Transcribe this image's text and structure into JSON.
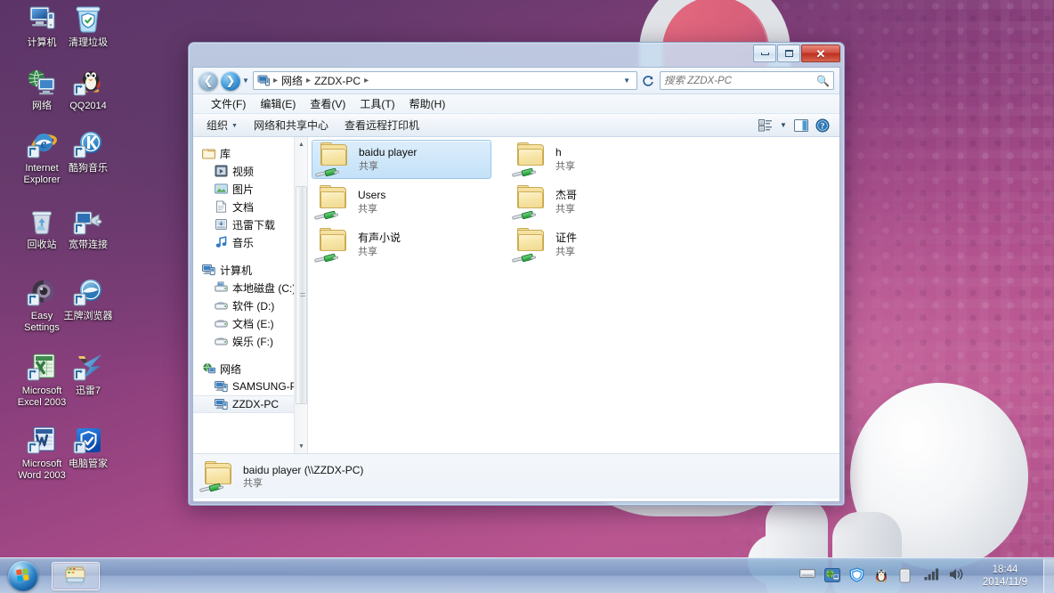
{
  "desktop": {
    "icons": [
      {
        "label": "计算机",
        "icon": "computer-icon"
      },
      {
        "label": "清理垃圾",
        "icon": "cleanup-trash-icon"
      },
      {
        "label": "网络",
        "icon": "network-icon"
      },
      {
        "label": "QQ2014",
        "icon": "qq-icon"
      },
      {
        "label": "Internet Explorer",
        "icon": "internet-explorer-icon"
      },
      {
        "label": "酷狗音乐",
        "icon": "kugou-music-icon"
      },
      {
        "label": "回收站",
        "icon": "recycle-bin-icon"
      },
      {
        "label": "宽带连接",
        "icon": "broadband-connection-icon"
      },
      {
        "label": "Easy Settings",
        "icon": "easy-settings-icon"
      },
      {
        "label": "王牌浏览器",
        "icon": "wangpai-browser-icon"
      },
      {
        "label": "Microsoft Excel 2003",
        "icon": "excel-icon"
      },
      {
        "label": "迅雷7",
        "icon": "thunder-icon"
      },
      {
        "label": "Microsoft Word 2003",
        "icon": "word-icon"
      },
      {
        "label": "电脑管家",
        "icon": "pc-manager-icon"
      }
    ]
  },
  "window": {
    "controls": {
      "minimize": "最小化",
      "maximize": "最大化",
      "close": "关闭"
    },
    "nav": {
      "back_label": "后退",
      "forward_label": "前进",
      "recent_label": "最近浏览的位置",
      "refresh_label": "刷新",
      "breadcrumbs": [
        "网络",
        "ZZDX-PC"
      ]
    },
    "search": {
      "placeholder": "搜索 ZZDX-PC",
      "value": ""
    },
    "menubar": [
      "文件(F)",
      "编辑(E)",
      "查看(V)",
      "工具(T)",
      "帮助(H)"
    ],
    "commandbar": {
      "organize": "组织",
      "network_center": "网络和共享中心",
      "view_remote_printers": "查看远程打印机",
      "views_label": "更改您的视图",
      "preview_label": "显示预览窗格",
      "help_label": "帮助"
    },
    "navpane": {
      "groups": [
        {
          "root": {
            "label": "库",
            "icon": "library-icon"
          },
          "children": [
            {
              "label": "视频",
              "icon": "videos-icon"
            },
            {
              "label": "图片",
              "icon": "pictures-icon"
            },
            {
              "label": "文档",
              "icon": "documents-icon"
            },
            {
              "label": "迅雷下载",
              "icon": "thunder-download-icon"
            },
            {
              "label": "音乐",
              "icon": "music-icon"
            }
          ]
        },
        {
          "root": {
            "label": "计算机",
            "icon": "computer-icon"
          },
          "children": [
            {
              "label": "本地磁盘 (C:)",
              "icon": "system-drive-icon"
            },
            {
              "label": "软件 (D:)",
              "icon": "drive-icon"
            },
            {
              "label": "文档 (E:)",
              "icon": "drive-icon"
            },
            {
              "label": "娱乐 (F:)",
              "icon": "drive-icon"
            }
          ]
        },
        {
          "root": {
            "label": "网络",
            "icon": "network-globe-icon"
          },
          "children": [
            {
              "label": "SAMSUNG-PC",
              "icon": "computer-icon",
              "selected": false
            },
            {
              "label": "ZZDX-PC",
              "icon": "computer-icon",
              "selected": true
            }
          ]
        }
      ]
    },
    "files": [
      {
        "name": "baidu player",
        "sub": "共享",
        "selected": true
      },
      {
        "name": "h",
        "sub": "共享",
        "selected": false
      },
      {
        "name": "Users",
        "sub": "共享",
        "selected": false
      },
      {
        "name": "杰哥",
        "sub": "共享",
        "selected": false
      },
      {
        "name": "有声小说",
        "sub": "共享",
        "selected": false
      },
      {
        "name": "证件",
        "sub": "共享",
        "selected": false
      }
    ],
    "details": {
      "name": "baidu player (\\\\ZZDX-PC)",
      "sub": "共享"
    }
  },
  "taskbar": {
    "start_label": "开始",
    "buttons": [
      {
        "label": "Windows 资源管理器",
        "icon": "explorer-icon",
        "active": true
      }
    ],
    "tray": [
      {
        "icon": "keyboard-icon"
      },
      {
        "icon": "network-manager-icon"
      },
      {
        "icon": "shield-icon"
      },
      {
        "icon": "qq-penguin-icon"
      },
      {
        "icon": "battery-icon"
      },
      {
        "icon": "signal-icon"
      },
      {
        "icon": "volume-icon"
      }
    ],
    "clock": {
      "time": "18:44",
      "date": "2014/11/9"
    },
    "show_desktop_label": "显示桌面"
  },
  "colors": {
    "accent": "#2a7fc4",
    "selection": "#c3e1f8",
    "close_button": "#bb3020",
    "desktop_purple": "#8a3f7c"
  }
}
